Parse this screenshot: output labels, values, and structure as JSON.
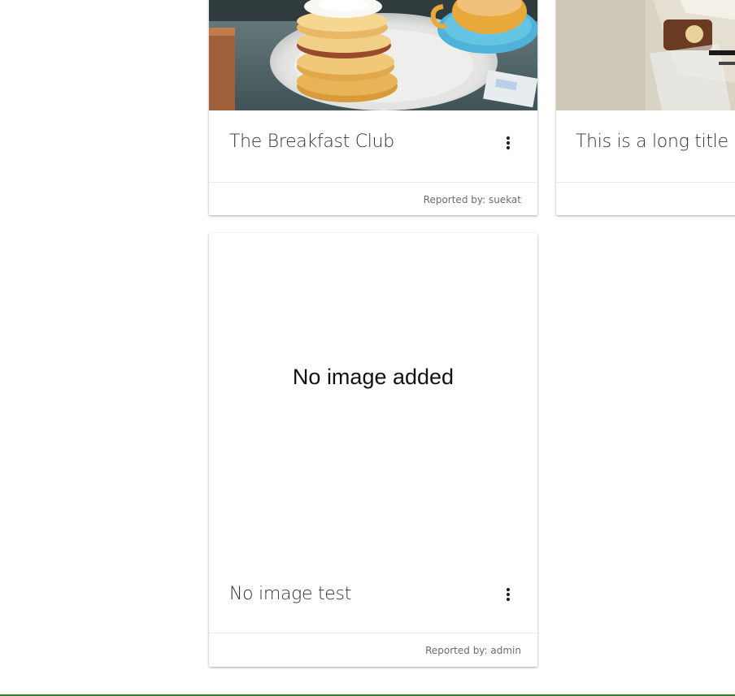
{
  "cards": [
    {
      "title": "The Breakfast Club",
      "reported_by": "Reported by: suekat",
      "has_image": true,
      "image_subject": "stack of pancakes on white plate with coffee cup"
    },
    {
      "title": "This is a long title as",
      "has_image": true,
      "image_subject": "packaged snack with printed label"
    },
    {
      "title": "No image test",
      "reported_by": "Reported by: admin",
      "has_image": false,
      "no_image_text": "No image added"
    }
  ],
  "icons": {
    "menu": "more-vert-icon"
  },
  "colors": {
    "accent_bottom_bar": "#2e7d32",
    "card_background": "#ffffff",
    "title_text": "#333333",
    "meta_text": "#6b6b6b"
  }
}
